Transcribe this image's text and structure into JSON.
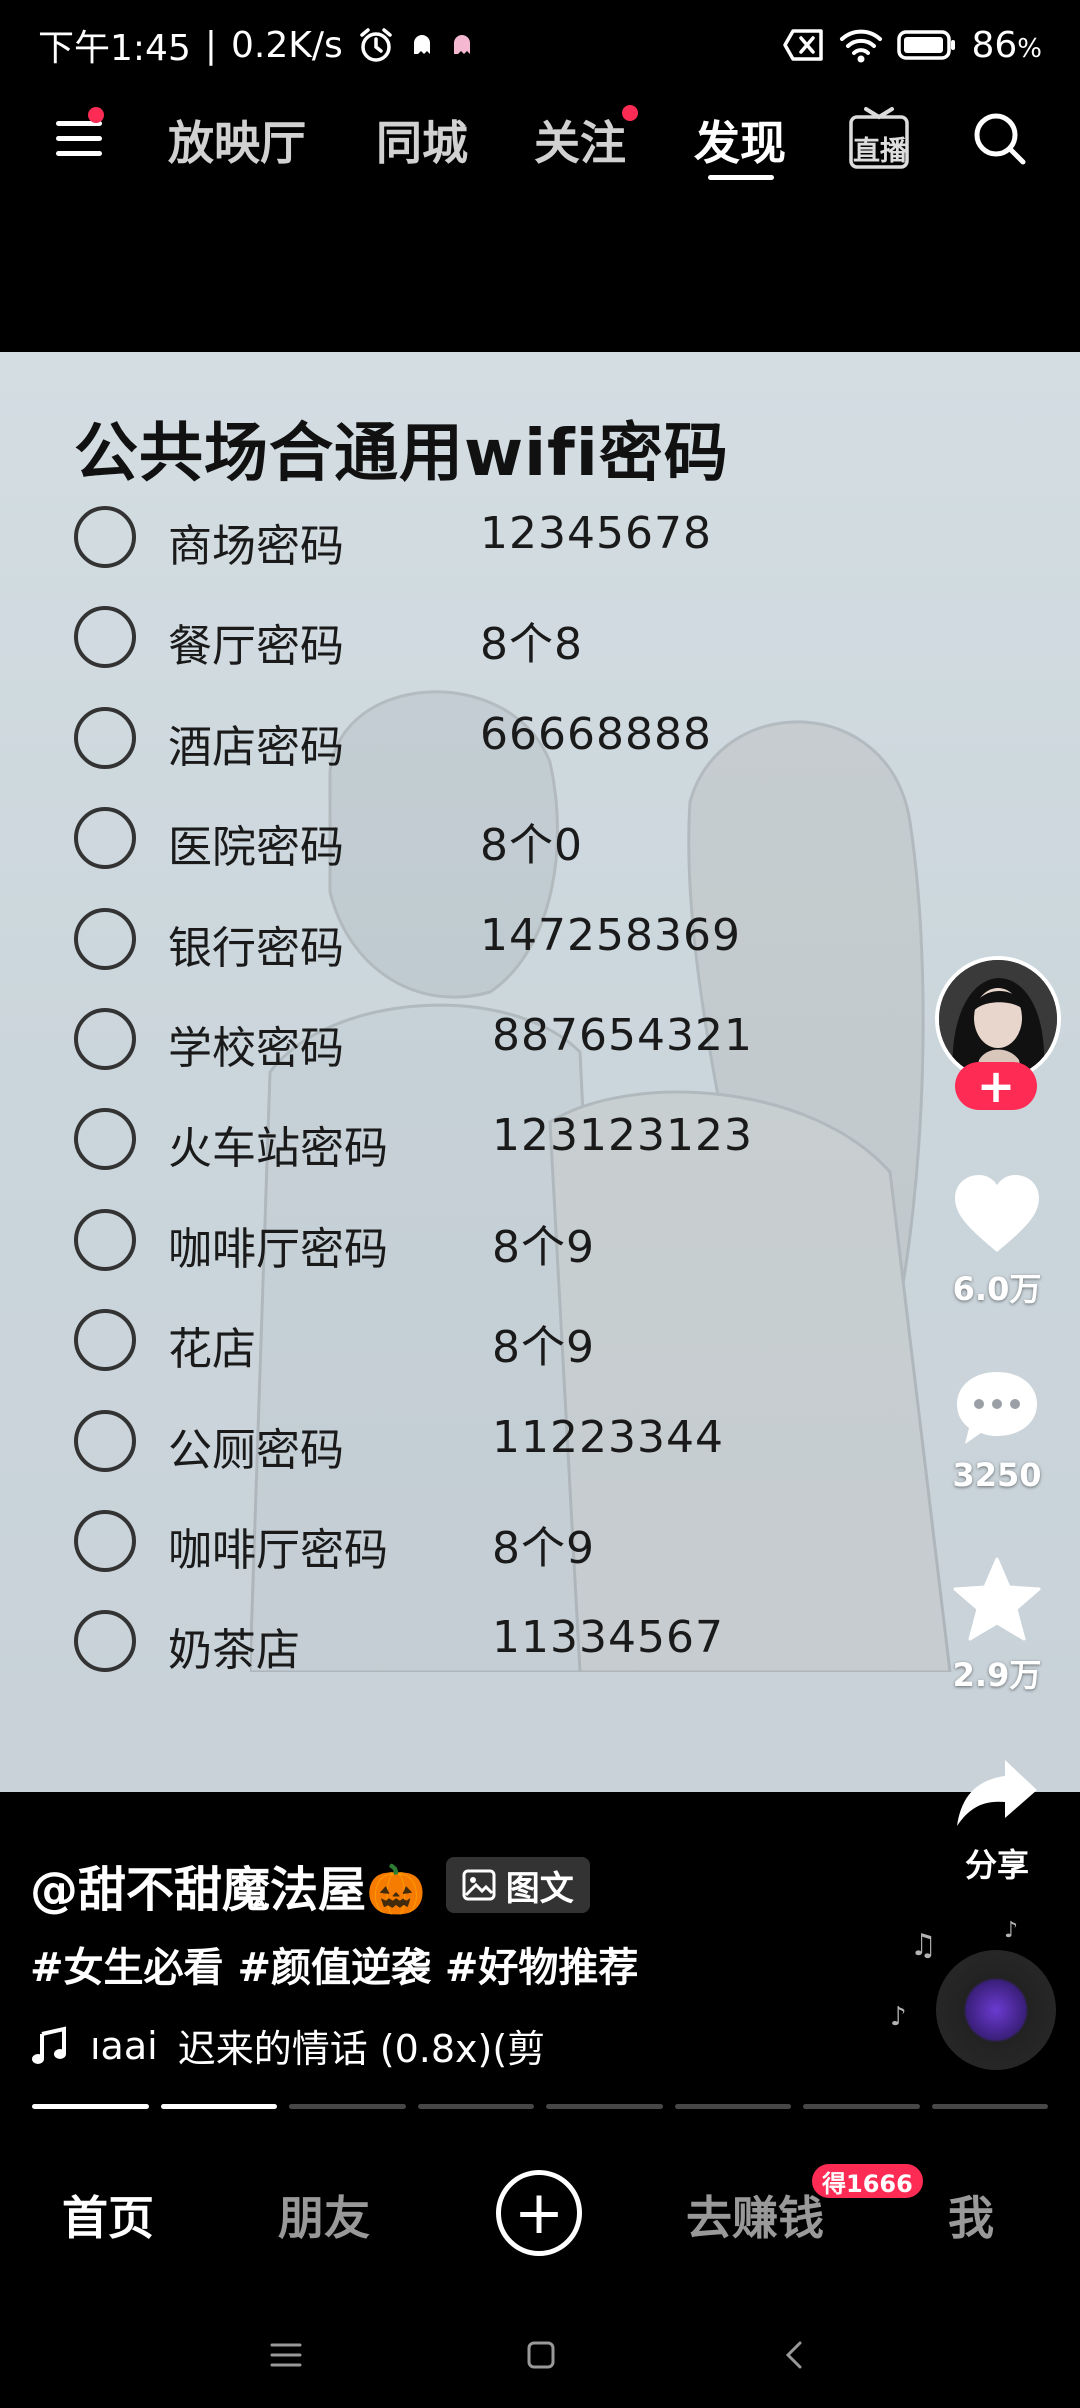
{
  "status_bar": {
    "time": "下午1:45",
    "speed": "0.2K/s",
    "battery": "86",
    "battery_unit": "%",
    "icons": [
      "alarm-icon",
      "ghost-icon",
      "sim-off-icon",
      "wifi-icon",
      "battery-icon"
    ]
  },
  "top_nav": {
    "tabs": [
      "放映厅",
      "同城",
      "关注",
      "发现"
    ],
    "active_tab": "发现",
    "live_label": "直播"
  },
  "post": {
    "title": "公共场合通用wifi密码",
    "rows": [
      {
        "label": "商场密码",
        "value": "12345678"
      },
      {
        "label": "餐厅密码",
        "value": "8个8"
      },
      {
        "label": "酒店密码",
        "value": "66668888"
      },
      {
        "label": "医院密码",
        "value": "8个0"
      },
      {
        "label": "银行密码",
        "value": "147258369"
      },
      {
        "label": "学校密码",
        "value": "887654321"
      },
      {
        "label": "火车站密码",
        "value": "123123123"
      },
      {
        "label": "咖啡厅密码",
        "value": "8个9"
      },
      {
        "label": "花店",
        "value": "8个9"
      },
      {
        "label": "公厕密码",
        "value": "11223344"
      },
      {
        "label": "咖啡厅密码",
        "value": "8个9"
      },
      {
        "label": "奶茶店",
        "value": "11334567"
      }
    ]
  },
  "actions": {
    "follow_label": "+",
    "likes": "6.0万",
    "comments": "3250",
    "favorites": "2.9万",
    "share_label": "分享"
  },
  "caption": {
    "author": "@甜不甜魔法屋🎃",
    "chip_label": "图文",
    "hashtags": "#女生必看 #颜值逆袭 #好物推荐",
    "music_prefix": "ıaai",
    "music": "迟来的情话 (0.8x)(剪"
  },
  "progress": {
    "total": 8,
    "done": 2
  },
  "tabbar": {
    "home": "首页",
    "friends": "朋友",
    "create": "+",
    "earn": "去赚钱",
    "earn_badge": "得1666",
    "me": "我"
  },
  "colors": {
    "accent": "#fe2c55",
    "background": "#000000",
    "card": "#cfd9de"
  }
}
